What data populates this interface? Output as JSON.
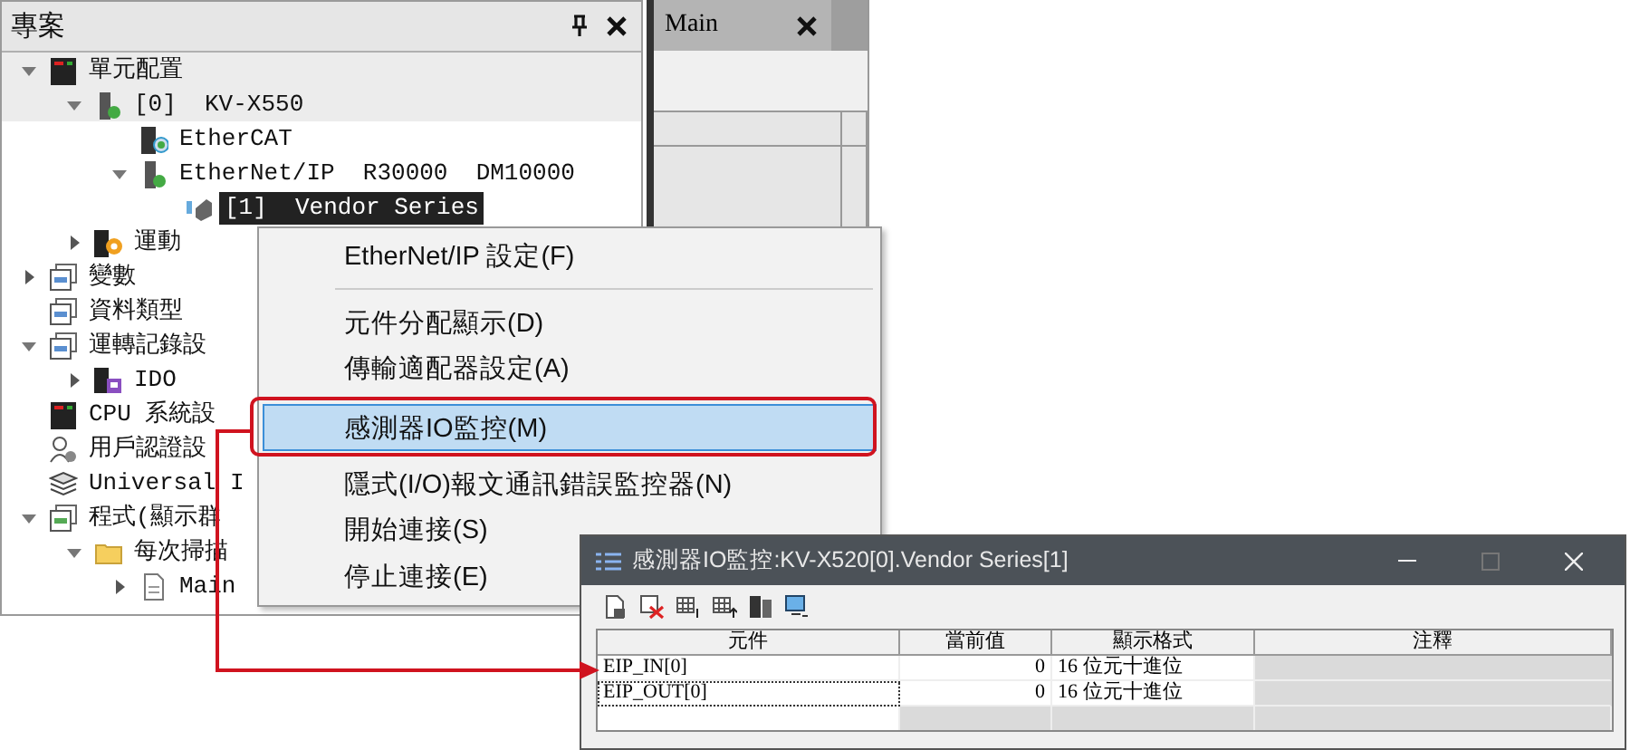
{
  "project_panel": {
    "title": "專案",
    "tree": [
      {
        "kind": "unit",
        "label": "單元配置",
        "expanded": true,
        "selected": false,
        "children": [
          {
            "kind": "cpu",
            "label": "[0]  KV-X550",
            "expanded": true,
            "selected": false,
            "children": [
              {
                "kind": "ethercat",
                "label": "EtherCAT",
                "selected": false
              },
              {
                "kind": "module",
                "label": "EtherNet/IP  R30000  DM10000",
                "expanded": true,
                "selected": false,
                "children": [
                  {
                    "kind": "device",
                    "label": "[1]  Vendor Series",
                    "selected": true
                  }
                ]
              }
            ]
          },
          {
            "kind": "motion",
            "label": "運動",
            "expanded": false,
            "selected": false
          }
        ]
      },
      {
        "kind": "variables",
        "label": "變數",
        "expanded": false,
        "selected": false
      },
      {
        "kind": "datatype",
        "label": "資料類型",
        "selected": false
      },
      {
        "kind": "log",
        "label": "運轉記錄設",
        "expanded": true,
        "selected": false,
        "children": [
          {
            "kind": "logfile",
            "label": "IDO",
            "expanded": false,
            "selected": false
          }
        ]
      },
      {
        "kind": "system",
        "label": "CPU 系統設",
        "selected": false
      },
      {
        "kind": "user",
        "label": "用戶認證設",
        "selected": false
      },
      {
        "kind": "library",
        "label": "Universal I",
        "selected": false
      },
      {
        "kind": "program",
        "label": "程式(顯示群",
        "expanded": true,
        "selected": false,
        "children": [
          {
            "kind": "folder",
            "label": "每次掃描",
            "expanded": true,
            "selected": false,
            "children": [
              {
                "kind": "file",
                "label": "Main",
                "expanded": false,
                "selected": false
              }
            ]
          }
        ]
      }
    ]
  },
  "editor": {
    "tab": {
      "label": "Main",
      "selected": true
    }
  },
  "context_menu": {
    "items": [
      {
        "kind": "item",
        "label": "EtherNet/IP 設定(F)",
        "selected": false
      },
      {
        "kind": "separator"
      },
      {
        "kind": "item",
        "label": "元件分配顯示(D)",
        "selected": false
      },
      {
        "kind": "item",
        "label": "傳輸適配器設定(A)",
        "selected": false
      },
      {
        "kind": "item",
        "label": "感測器IO監控(M)",
        "selected": true
      },
      {
        "kind": "item",
        "label": "隱式(I/O)報文通訊錯誤監控器(N)",
        "selected": false
      },
      {
        "kind": "item",
        "label": "開始連接(S)",
        "selected": false
      },
      {
        "kind": "item",
        "label": "停止連接(E)",
        "selected": false
      }
    ]
  },
  "monitor_window": {
    "title": "感測器IO監控:KV-X520[0].Vendor Series[1]",
    "columns": [
      "元件",
      "當前值",
      "顯示格式",
      "注釋"
    ],
    "rows": [
      {
        "cells": [
          "EIP_IN[0]",
          "0",
          "16 位元十進位",
          ""
        ]
      },
      {
        "cells": [
          "EIP_OUT[0]",
          "0",
          "16 位元十進位",
          ""
        ]
      }
    ]
  }
}
